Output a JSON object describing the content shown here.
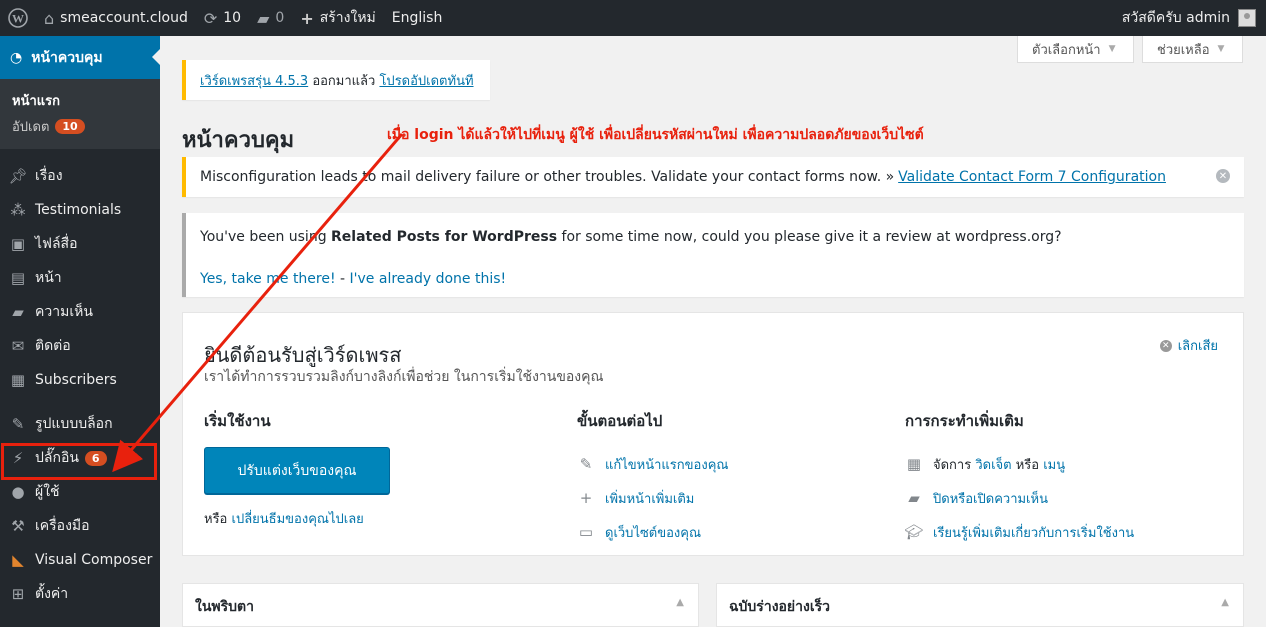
{
  "adminbar": {
    "site_name": "smeaccount.cloud",
    "updates_count": "10",
    "comments_count": "0",
    "new_label": "สร้างใหม่",
    "language": "English",
    "greeting": "สวัสดีครับ admin"
  },
  "sidebar": {
    "current": "หน้าควบคุม",
    "submenu": [
      {
        "label": "หน้าแรก"
      },
      {
        "label": "อัปเดต",
        "badge": "10"
      }
    ],
    "items": [
      {
        "label": "เรื่อง",
        "icon": "pin-icon"
      },
      {
        "label": "Testimonials",
        "icon": "users-icon"
      },
      {
        "label": "ไฟล์สื่อ",
        "icon": "media-icon"
      },
      {
        "label": "หน้า",
        "icon": "page-icon"
      },
      {
        "label": "ความเห็น",
        "icon": "comment-icon"
      },
      {
        "label": "ติดต่อ",
        "icon": "mail-icon"
      },
      {
        "label": "Subscribers",
        "icon": "list-icon"
      },
      {
        "label": "รูปแบบบล็อก",
        "icon": "brush-icon"
      },
      {
        "label": "ปลั๊กอิน",
        "icon": "plugin-icon",
        "badge": "6"
      },
      {
        "label": "ผู้ใช้",
        "icon": "user-icon"
      },
      {
        "label": "เครื่องมือ",
        "icon": "wrench-icon"
      },
      {
        "label": "Visual Composer",
        "icon": "vc-icon"
      },
      {
        "label": "ตั้งค่า",
        "icon": "settings-icon"
      }
    ]
  },
  "screen_tabs": {
    "options": "ตัวเลือกหน้า",
    "help": "ช่วยเหลือ"
  },
  "update_nag": {
    "version_link": "เวิร์ดเพรสรุ่น 4.5.3",
    "text": " ออกมาแล้ว ",
    "update_link": "โปรดอัปเดตทันที"
  },
  "page_title": "หน้าควบคุม",
  "annotation": "เมื่อ login ได้แล้วให้ไปที่เมนู ผู้ใช้ เพื่อเปลี่ยนรหัสผ่านใหม่ เพื่อความปลอดภัยของเว็บไซต์",
  "notice_warn": {
    "text": "Misconfiguration leads to mail delivery failure or other troubles. Validate your contact forms now. »",
    "link": "Validate Contact Form 7 Configuration"
  },
  "notice_info": {
    "pre": "You've been using ",
    "strong": "Related Posts for WordPress",
    "post": " for some time now, could you please give it a review at wordpress.org?",
    "link_yes": "Yes, take me there!",
    "sep": " - ",
    "link_done": "I've already done this!"
  },
  "welcome": {
    "title": "ยินดีต้อนรับสู่เวิร์ดเพรส",
    "about": "เราได้ทำการรวบรวมลิงก์บางลิงก์เพื่อช่วย ในการเริ่มใช้งานของคุณ",
    "dismiss": "เลิกเสีย",
    "col1": {
      "title": "เริ่มใช้งาน",
      "button": "ปรับแต่งเว็บของคุณ",
      "or": "หรือ ",
      "or_link": "เปลี่ยนธีมของคุณไปเลย"
    },
    "col2": {
      "title": "ขั้นตอนต่อไป",
      "items": [
        {
          "label": "แก้ไขหน้าแรกของคุณ",
          "icon": "edit-icon"
        },
        {
          "label": "เพิ่มหน้าเพิ่มเติม",
          "icon": "plus-icon"
        },
        {
          "label": "ดูเว็บไซต์ของคุณ",
          "icon": "view-icon"
        }
      ]
    },
    "col3": {
      "title": "การกระทำเพิ่มเติม",
      "manage_pre": "จัดการ ",
      "widgets": "วิดเจ็ต",
      "or": " หรือ ",
      "menus": "เมนู",
      "comments": "ปิดหรือเปิดความเห็น",
      "learn": "เรียนรู้เพิ่มเติมเกี่ยวกับการเริ่มใช้งาน"
    }
  },
  "boxes": {
    "left": "ในพริบตา",
    "right": "ฉบับร่างอย่างเร็ว"
  },
  "colors": {
    "accent": "#0073aa",
    "annotation": "#e8210d",
    "sidebar": "#23282d"
  }
}
